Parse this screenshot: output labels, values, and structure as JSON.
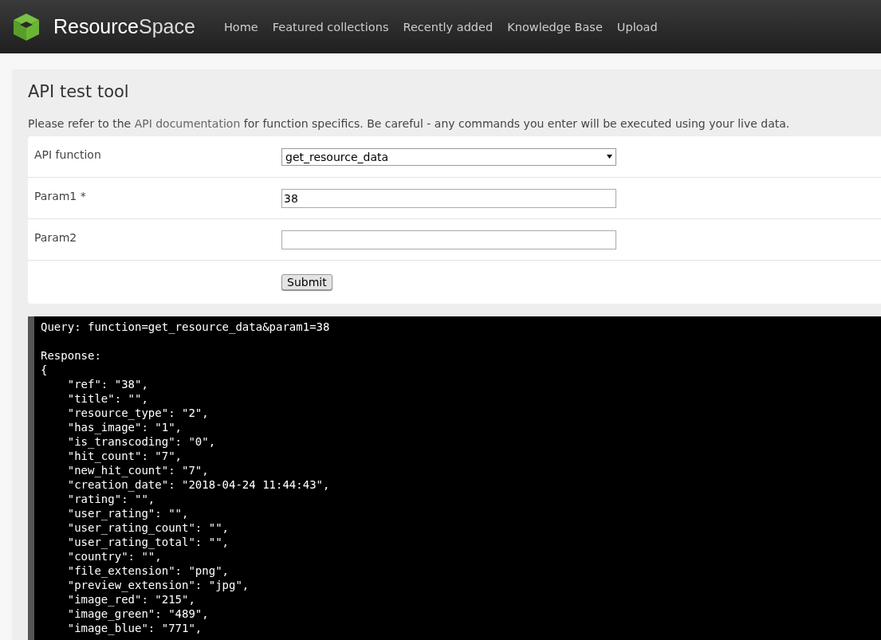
{
  "header": {
    "logo_text_bold": "Resource",
    "logo_text_light": "Space",
    "nav": [
      {
        "label": "Home"
      },
      {
        "label": "Featured collections"
      },
      {
        "label": "Recently added"
      },
      {
        "label": "Knowledge Base"
      },
      {
        "label": "Upload"
      }
    ]
  },
  "page": {
    "title": "API test tool",
    "intro": {
      "before": "Please refer to the",
      "link": "API documentation",
      "after": "for function specifics. Be careful - any commands you enter will be executed using your live data."
    }
  },
  "form": {
    "rows": [
      {
        "kind": "select",
        "label": "API function",
        "value": "get_resource_data"
      },
      {
        "kind": "input",
        "label": "Param1 *",
        "value": "38"
      },
      {
        "kind": "input",
        "label": "Param2",
        "value": ""
      },
      {
        "kind": "submit",
        "label": "",
        "value": "Submit"
      }
    ]
  },
  "output": {
    "query": "Query: function=get_resource_data&param1=38",
    "response_label": "Response:",
    "lines": [
      "{",
      "    \"ref\": \"38\",",
      "    \"title\": \"\",",
      "    \"resource_type\": \"2\",",
      "    \"has_image\": \"1\",",
      "    \"is_transcoding\": \"0\",",
      "    \"hit_count\": \"7\",",
      "    \"new_hit_count\": \"7\",",
      "    \"creation_date\": \"2018-04-24 11:44:43\",",
      "    \"rating\": \"\",",
      "    \"user_rating\": \"\",",
      "    \"user_rating_count\": \"\",",
      "    \"user_rating_total\": \"\",",
      "    \"country\": \"\",",
      "    \"file_extension\": \"png\",",
      "    \"preview_extension\": \"jpg\",",
      "    \"image_red\": \"215\",",
      "    \"image_green\": \"489\",",
      "    \"image_blue\": \"771\","
    ]
  }
}
